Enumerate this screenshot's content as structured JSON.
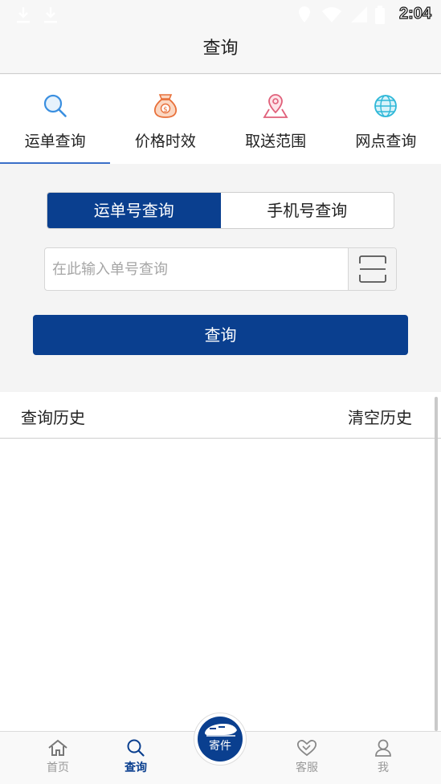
{
  "status_bar": {
    "time": "2:04"
  },
  "nav": {
    "title": "查询"
  },
  "category_tabs": [
    {
      "label": "运单查询",
      "icon": "search-icon",
      "color": "#3a8fe0"
    },
    {
      "label": "价格时效",
      "icon": "money-bag-icon",
      "color": "#e8703a"
    },
    {
      "label": "取送范围",
      "icon": "location-range-icon",
      "color": "#e0607a"
    },
    {
      "label": "网点查询",
      "icon": "globe-icon",
      "color": "#2fb8d8"
    }
  ],
  "query_mode": {
    "options": [
      "运单号查询",
      "手机号查询"
    ],
    "selected": "运单号查询"
  },
  "search": {
    "placeholder": "在此输入单号查询",
    "value": ""
  },
  "query_button": "查询",
  "history": {
    "title": "查询历史",
    "clear_label": "清空历史"
  },
  "tabbar": {
    "items": [
      {
        "label": "首页",
        "icon": "home-icon"
      },
      {
        "label": "查询",
        "icon": "search-icon"
      },
      {
        "label": "客服",
        "icon": "handshake-icon"
      },
      {
        "label": "我",
        "icon": "user-icon"
      }
    ],
    "center": {
      "label": "寄件",
      "icon": "train-icon"
    },
    "active": "查询"
  },
  "colors": {
    "primary": "#0a3f8f",
    "accent_underline": "#3a6fc8"
  }
}
